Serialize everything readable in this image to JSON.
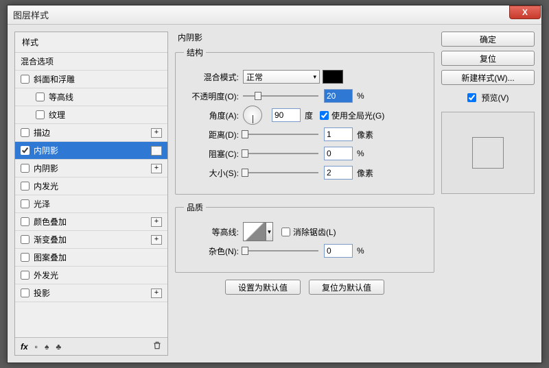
{
  "window": {
    "title": "图层样式"
  },
  "buttons": {
    "close_glyph": "X",
    "ok": "确定",
    "reset": "复位",
    "new_style": "新建样式(W)...",
    "preview": "预览(V)"
  },
  "left": {
    "header": "样式",
    "blending_options": "混合选项",
    "footer": {
      "fx": "fx",
      "dot": "▪",
      "up": "✦",
      "down": "↓"
    },
    "items": [
      {
        "label": "斜面和浮雕",
        "checked": false,
        "indent": false,
        "plus": false,
        "selected": false
      },
      {
        "label": "等高线",
        "checked": false,
        "indent": true,
        "plus": false,
        "selected": false
      },
      {
        "label": "纹理",
        "checked": false,
        "indent": true,
        "plus": false,
        "selected": false
      },
      {
        "label": "描边",
        "checked": false,
        "indent": false,
        "plus": true,
        "selected": false
      },
      {
        "label": "内阴影",
        "checked": true,
        "indent": false,
        "plus": true,
        "selected": true
      },
      {
        "label": "内阴影",
        "checked": false,
        "indent": false,
        "plus": true,
        "selected": false
      },
      {
        "label": "内发光",
        "checked": false,
        "indent": false,
        "plus": false,
        "selected": false
      },
      {
        "label": "光泽",
        "checked": false,
        "indent": false,
        "plus": false,
        "selected": false
      },
      {
        "label": "颜色叠加",
        "checked": false,
        "indent": false,
        "plus": true,
        "selected": false
      },
      {
        "label": "渐变叠加",
        "checked": false,
        "indent": false,
        "plus": true,
        "selected": false
      },
      {
        "label": "图案叠加",
        "checked": false,
        "indent": false,
        "plus": false,
        "selected": false
      },
      {
        "label": "外发光",
        "checked": false,
        "indent": false,
        "plus": false,
        "selected": false
      },
      {
        "label": "投影",
        "checked": false,
        "indent": false,
        "plus": true,
        "selected": false
      }
    ]
  },
  "center": {
    "title": "内阴影",
    "structure": {
      "legend": "结构",
      "blend_mode_label": "混合模式:",
      "blend_mode_value": "正常",
      "opacity_label": "不透明度(O):",
      "opacity_value": "20",
      "opacity_unit": "%",
      "opacity_pct": 20,
      "angle_label": "角度(A):",
      "angle_value": "90",
      "angle_unit": "度",
      "global_light": "使用全局光(G)",
      "distance_label": "距离(D):",
      "distance_value": "1",
      "distance_unit": "像素",
      "distance_pct": 1,
      "choke_label": "阻塞(C):",
      "choke_value": "0",
      "choke_unit": "%",
      "choke_pct": 0,
      "size_label": "大小(S):",
      "size_value": "2",
      "size_unit": "像素",
      "size_pct": 2
    },
    "quality": {
      "legend": "品质",
      "contour_label": "等高线:",
      "antialias": "消除锯齿(L)",
      "noise_label": "杂色(N):",
      "noise_value": "0",
      "noise_unit": "%",
      "noise_pct": 0
    },
    "make_default": "设置为默认值",
    "reset_default": "复位为默认值"
  }
}
